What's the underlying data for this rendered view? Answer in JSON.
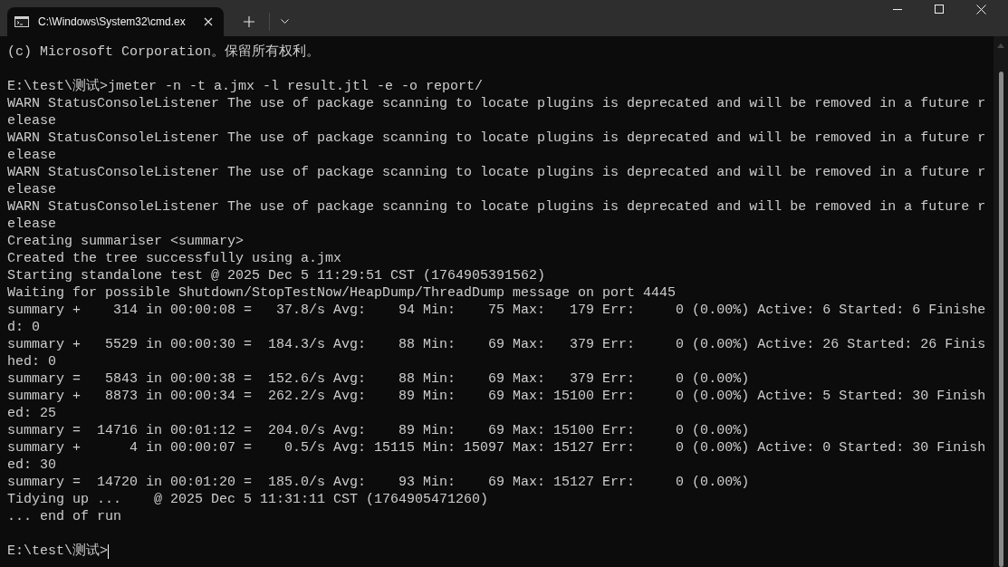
{
  "tabs": [
    {
      "title": "C:\\Windows\\System32\\cmd.ex",
      "selected": true
    }
  ],
  "console": {
    "blocks": [
      [
        "(c) Microsoft Corporation。保留所有权利。"
      ],
      [
        "E:\\test\\测试>jmeter -n -t a.jmx -l result.jtl -e -o report/",
        "WARN StatusConsoleListener The use of package scanning to locate plugins is deprecated and will be removed in a future r",
        "elease",
        "WARN StatusConsoleListener The use of package scanning to locate plugins is deprecated and will be removed in a future r",
        "elease",
        "WARN StatusConsoleListener The use of package scanning to locate plugins is deprecated and will be removed in a future r",
        "elease",
        "WARN StatusConsoleListener The use of package scanning to locate plugins is deprecated and will be removed in a future r",
        "elease",
        "Creating summariser <summary>",
        "Created the tree successfully using a.jmx",
        "Starting standalone test @ 2025 Dec 5 11:29:51 CST (1764905391562)",
        "Waiting for possible Shutdown/StopTestNow/HeapDump/ThreadDump message on port 4445",
        "summary +    314 in 00:00:08 =   37.8/s Avg:    94 Min:    75 Max:   179 Err:     0 (0.00%) Active: 6 Started: 6 Finishe",
        "d: 0",
        "summary +   5529 in 00:00:30 =  184.3/s Avg:    88 Min:    69 Max:   379 Err:     0 (0.00%) Active: 26 Started: 26 Finis",
        "hed: 0",
        "summary =   5843 in 00:00:38 =  152.6/s Avg:    88 Min:    69 Max:   379 Err:     0 (0.00%)",
        "summary +   8873 in 00:00:34 =  262.2/s Avg:    89 Min:    69 Max: 15100 Err:     0 (0.00%) Active: 5 Started: 30 Finish",
        "ed: 25",
        "summary =  14716 in 00:01:12 =  204.0/s Avg:    89 Min:    69 Max: 15100 Err:     0 (0.00%)",
        "summary +      4 in 00:00:07 =    0.5/s Avg: 15115 Min: 15097 Max: 15127 Err:     0 (0.00%) Active: 0 Started: 30 Finish",
        "ed: 30",
        "summary =  14720 in 00:01:20 =  185.0/s Avg:    93 Min:    69 Max: 15127 Err:     0 (0.00%)",
        "Tidying up ...    @ 2025 Dec 5 11:31:11 CST (1764905471260)",
        "... end of run"
      ],
      [
        "E:\\test\\测试>"
      ]
    ]
  }
}
